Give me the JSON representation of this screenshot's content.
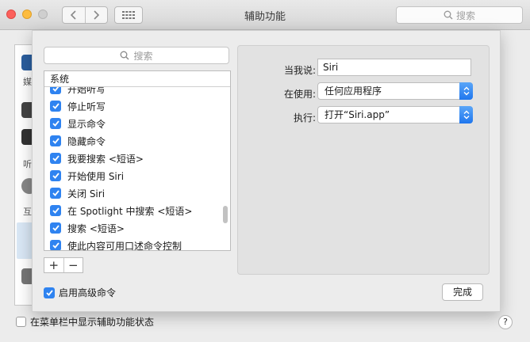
{
  "window": {
    "title": "辅助功能",
    "search_placeholder": "搜索"
  },
  "sheet": {
    "search_placeholder": "搜索",
    "list_header": "系统",
    "commands": [
      "开始听写",
      "停止听写",
      "显示命令",
      "隐藏命令",
      "我要搜索 <短语>",
      "开始使用 Siri",
      "关闭 Siri",
      "在 Spotlight 中搜索 <短语>",
      "搜索 <短语>",
      "使此内容可用口述命令控制"
    ],
    "plus": "+",
    "minus": "−",
    "fields": {
      "when_i_say_label": "当我说:",
      "when_i_say_value": "Siri",
      "while_using_label": "在使用:",
      "while_using_value": "任何应用程序",
      "perform_label": "执行:",
      "perform_value": "打开“Siri.app”"
    },
    "advanced_commands_label": "启用高级命令",
    "done_label": "完成"
  },
  "background": {
    "sidebar_fragments": [
      "媒",
      "听",
      "互"
    ],
    "menu_bar_status_label": "在菜单栏中显示辅助功能状态",
    "help": "?"
  },
  "colors": {
    "accent": "#2f83f0"
  }
}
